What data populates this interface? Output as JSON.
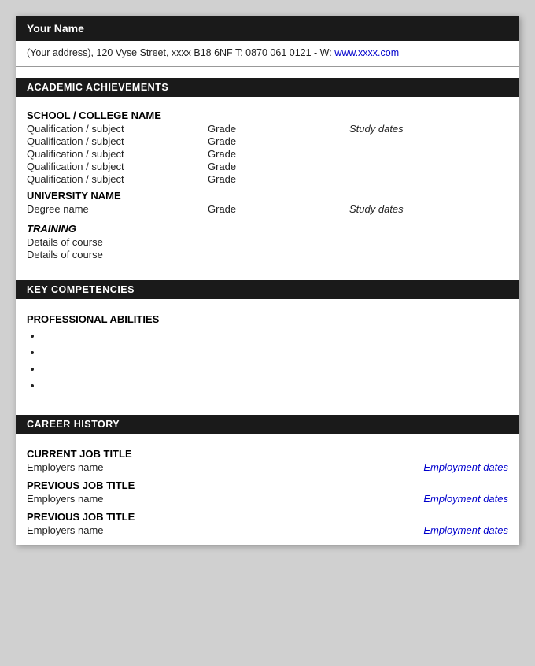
{
  "header": {
    "name": "Your Name",
    "address": "(Your address), 120 Vyse Street, xxxx B18 6NF T: 0870 061 0121 - W: ",
    "website_label": "www.xxxx.com",
    "website_url": "#"
  },
  "sections": {
    "academic": {
      "title": "ACADEMIC ACHIEVEMENTS",
      "school": {
        "name": "SCHOOL / COLLEGE NAME",
        "qualifications": [
          {
            "subject": "Qualification / subject",
            "grade": "Grade",
            "dates": "Study dates"
          },
          {
            "subject": "Qualification / subject",
            "grade": "Grade",
            "dates": ""
          },
          {
            "subject": "Qualification / subject",
            "grade": "Grade",
            "dates": ""
          },
          {
            "subject": "Qualification / subject",
            "grade": "Grade",
            "dates": ""
          },
          {
            "subject": "Qualification / subject",
            "grade": "Grade",
            "dates": ""
          }
        ]
      },
      "university": {
        "name": "UNIVERSITY NAME",
        "qualifications": [
          {
            "subject": "Degree name",
            "grade": "Grade",
            "dates": "Study dates"
          }
        ]
      },
      "training": {
        "title": "TRAINING",
        "details": [
          "Details of course",
          "Details of course"
        ]
      }
    },
    "competencies": {
      "title": "KEY COMPETENCIES",
      "sub_heading": "PROFESSIONAL ABILITIES",
      "bullets": [
        "",
        "",
        "",
        ""
      ]
    },
    "career": {
      "title": "CAREER HISTORY",
      "jobs": [
        {
          "title": "CURRENT JOB TITLE",
          "employer": "Employers name",
          "dates": "Employment dates"
        },
        {
          "title": "PREVIOUS JOB TITLE",
          "employer": "Employers name",
          "dates": "Employment dates"
        },
        {
          "title": "PREVIOUS JOB TITLE",
          "employer": "Employers name",
          "dates": "Employment dates"
        }
      ]
    }
  }
}
